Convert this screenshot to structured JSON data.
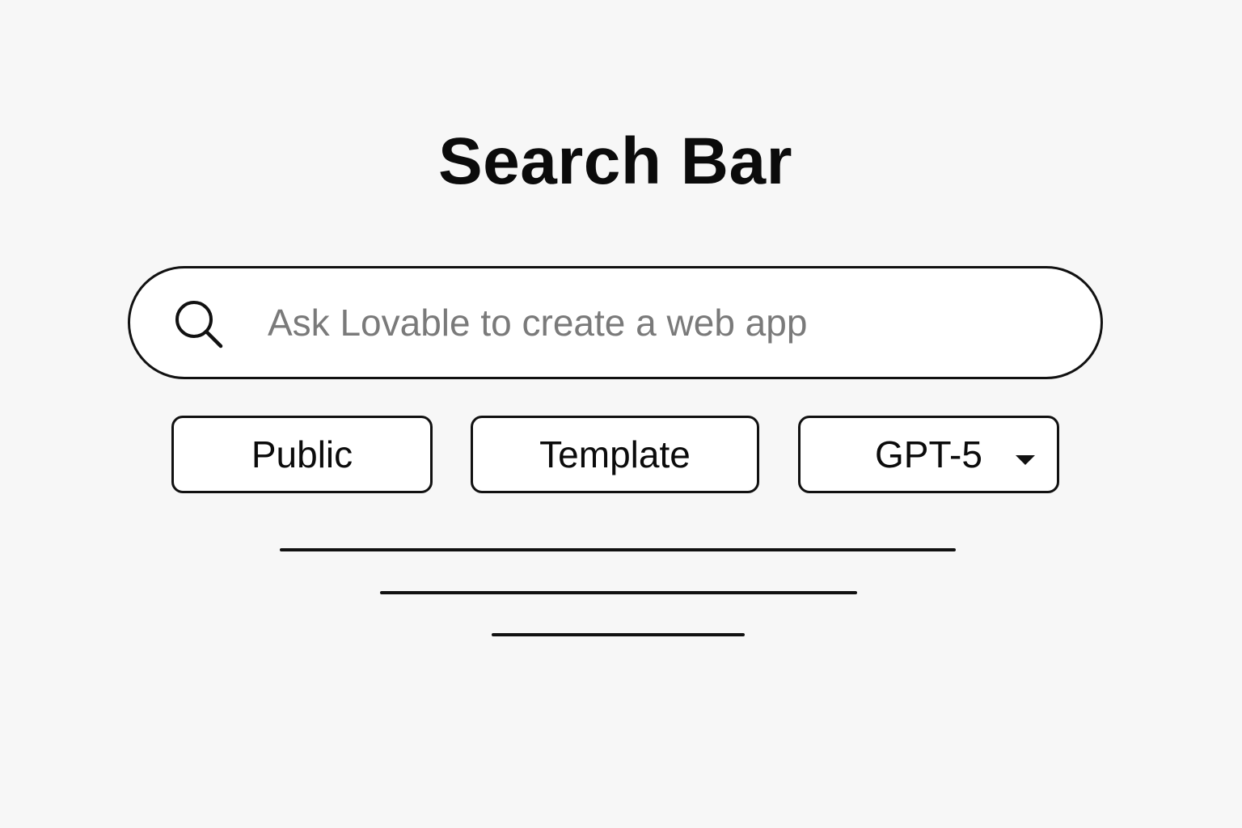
{
  "header": {
    "title": "Search Bar"
  },
  "search": {
    "value": "",
    "placeholder": "Ask Lovable to create a web app",
    "icon": "search-icon"
  },
  "options": {
    "visibility_label": "Public",
    "template_label": "Template",
    "model_selector": {
      "selected": "GPT-5",
      "icon": "chevron-down-icon"
    }
  },
  "colors": {
    "background": "#f7f7f7",
    "stroke": "#111111",
    "placeholder": "#7a7a7a",
    "surface": "#ffffff"
  }
}
